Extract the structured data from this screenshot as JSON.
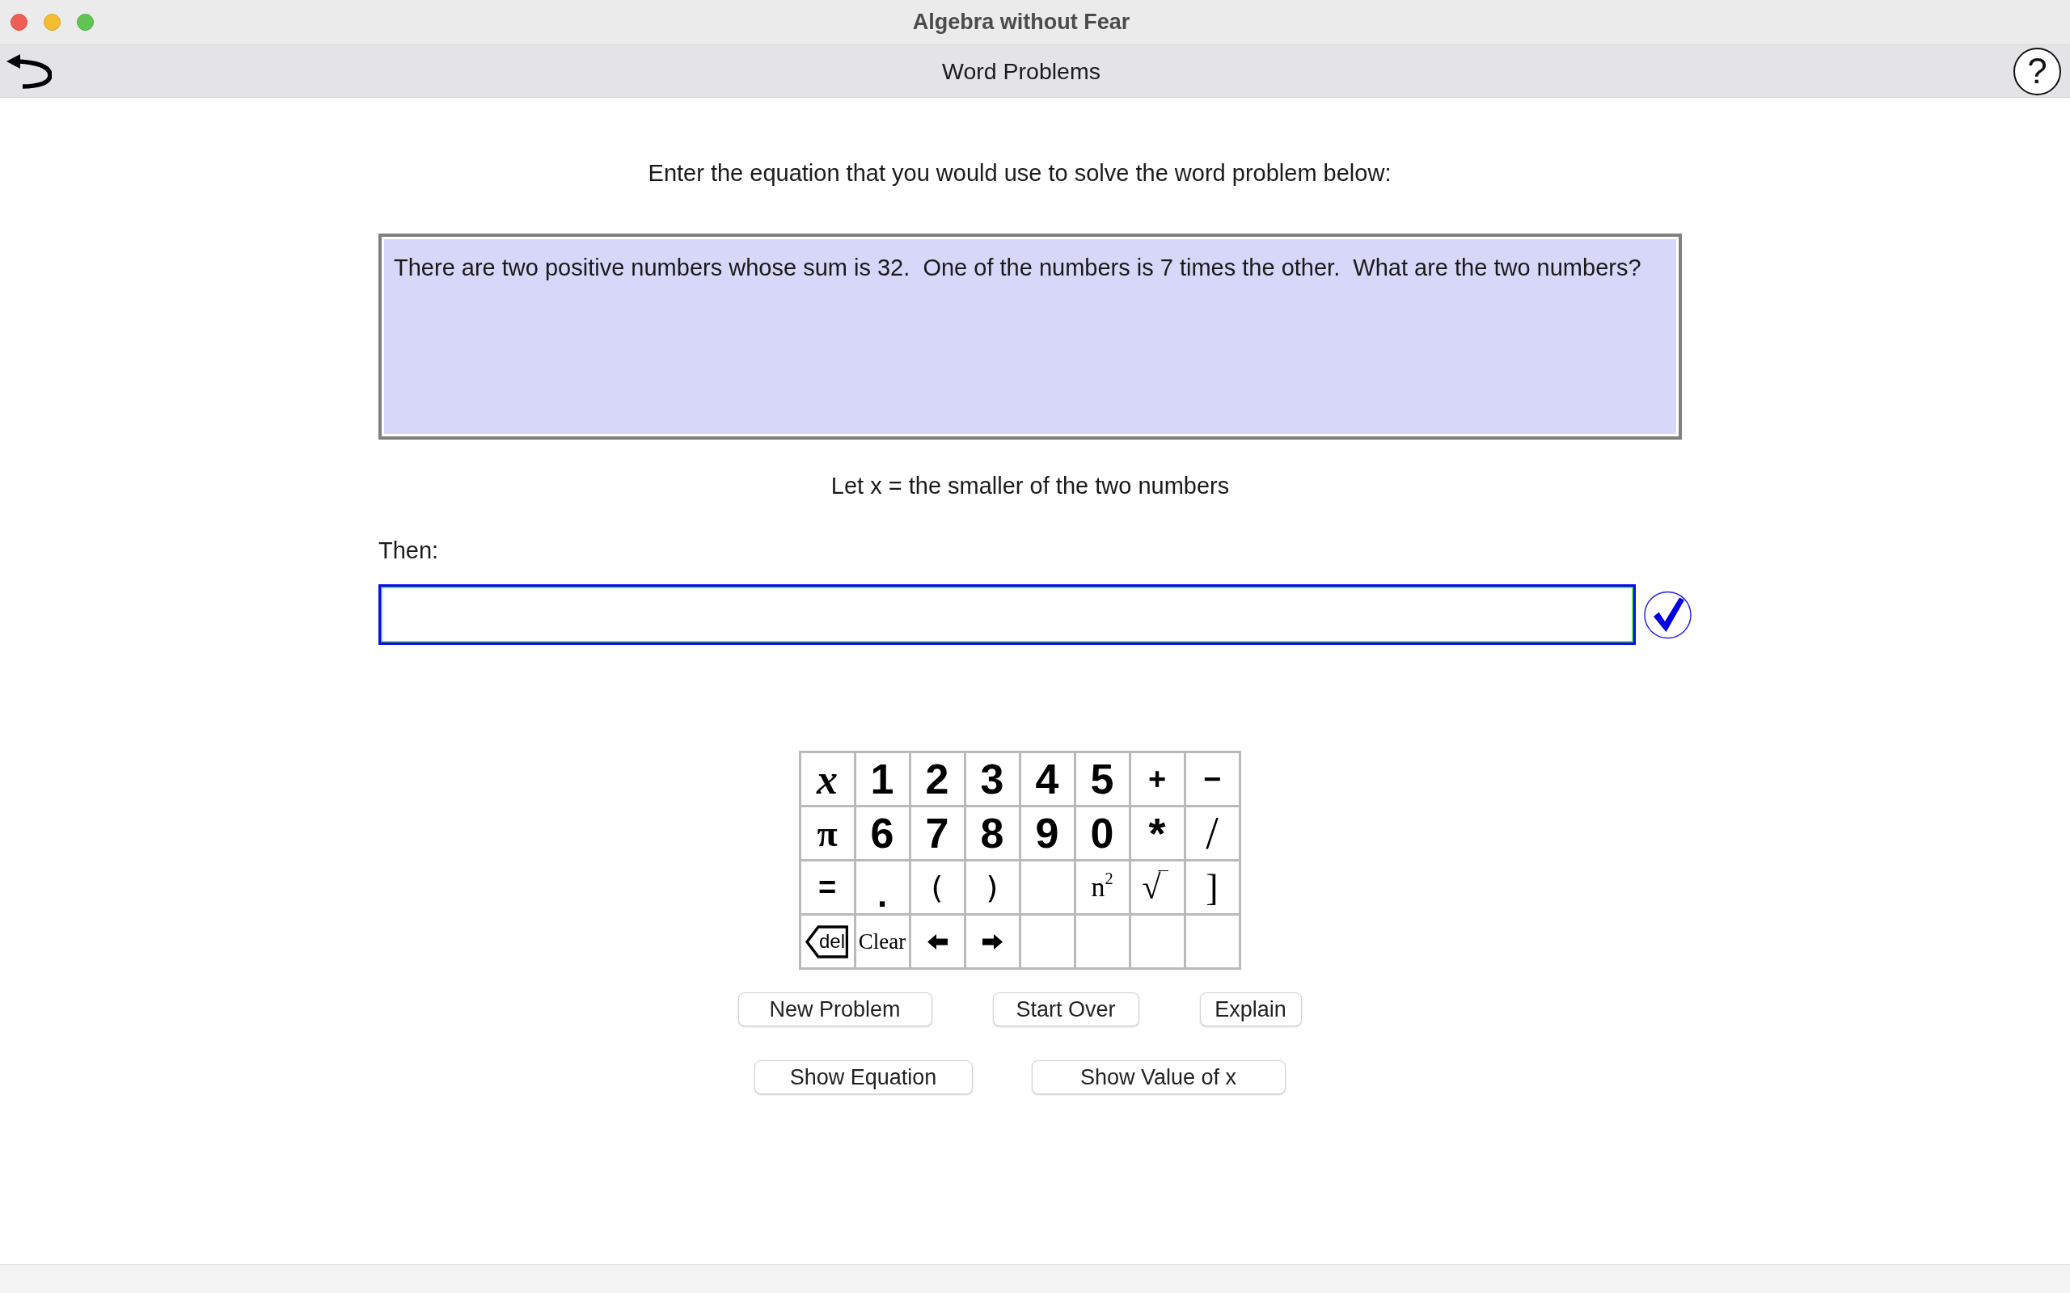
{
  "window": {
    "title": "Algebra without Fear"
  },
  "toolbar": {
    "title": "Word Problems",
    "help": "?"
  },
  "instruction": "Enter the equation that you would use to solve the word problem below:",
  "problem": {
    "text": "There are two positive numbers whose sum is 32.  One of the numbers is 7 times the other.  What are the two numbers?"
  },
  "definition": "Let x = the smaller of the two numbers",
  "answer": {
    "label": "Then:",
    "focused": true
  },
  "keypad": {
    "rows": [
      [
        {
          "label": "x",
          "kind": "variable"
        },
        {
          "label": "1",
          "kind": "digit"
        },
        {
          "label": "2",
          "kind": "digit"
        },
        {
          "label": "3",
          "kind": "digit"
        },
        {
          "label": "4",
          "kind": "digit"
        },
        {
          "label": "5",
          "kind": "digit"
        },
        {
          "label": "+",
          "kind": "operator"
        },
        {
          "label": "−",
          "kind": "operator"
        }
      ],
      [
        {
          "label": "π",
          "kind": "constant"
        },
        {
          "label": "6",
          "kind": "digit"
        },
        {
          "label": "7",
          "kind": "digit"
        },
        {
          "label": "8",
          "kind": "digit"
        },
        {
          "label": "9",
          "kind": "digit"
        },
        {
          "label": "0",
          "kind": "digit"
        },
        {
          "label": "*",
          "kind": "asterisk"
        },
        {
          "label": "/",
          "kind": "slash"
        }
      ],
      [
        {
          "label": "=",
          "kind": "operator"
        },
        {
          "label": ".",
          "kind": "point"
        },
        {
          "label": "(",
          "kind": "paren"
        },
        {
          "label": ")",
          "kind": "paren"
        },
        {
          "kind": "blank"
        },
        {
          "label": "n$^{2}$",
          "kind": "power"
        },
        {
          "label": "√",
          "kind": "root"
        },
        {
          "label": "]",
          "kind": "bracket"
        }
      ],
      [
        {
          "label": "del",
          "kind": "delete"
        },
        {
          "label": "Clear",
          "kind": "clear"
        },
        {
          "kind": "left"
        },
        {
          "kind": "right"
        },
        {
          "kind": "blank"
        },
        {
          "kind": "blank"
        },
        {
          "kind": "blank"
        },
        {
          "kind": "blank"
        }
      ]
    ]
  },
  "buttons": [
    [
      "New Problem",
      "Start Over",
      "Explain"
    ],
    [
      "Show Equation",
      "Show Value of x"
    ]
  ]
}
